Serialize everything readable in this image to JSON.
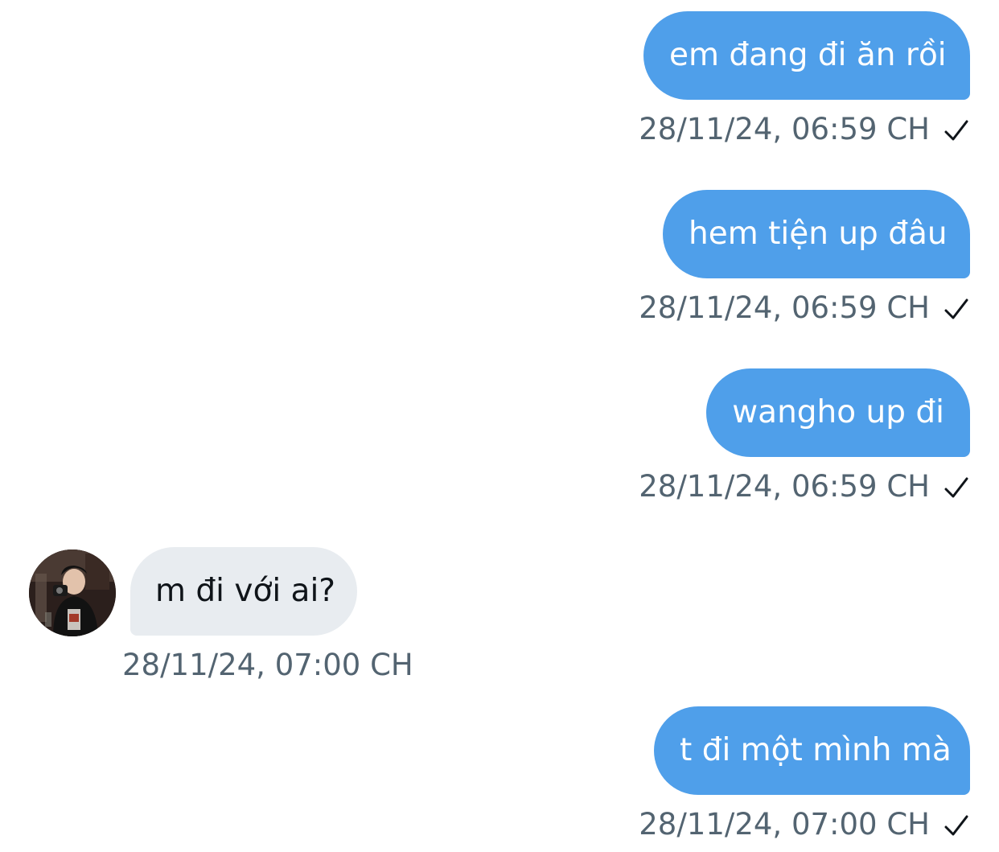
{
  "messages": [
    {
      "direction": "outgoing",
      "text": "em đang đi ăn rồi",
      "time": "28/11/24, 06:59 CH",
      "status_icon": "check-icon"
    },
    {
      "direction": "outgoing",
      "text": "hem tiện up đâu",
      "time": "28/11/24, 06:59 CH",
      "status_icon": "check-icon"
    },
    {
      "direction": "outgoing",
      "text": "wangho up đi",
      "time": "28/11/24, 06:59 CH",
      "status_icon": "check-icon"
    },
    {
      "direction": "incoming",
      "text": "m đi với ai?",
      "time": "28/11/24, 07:00 CH",
      "avatar": "user-avatar"
    },
    {
      "direction": "outgoing",
      "text": "t đi một mình mà",
      "time": "28/11/24, 07:00 CH",
      "status_icon": "check-icon"
    }
  ],
  "colors": {
    "outgoing_bubble": "#4f9fea",
    "incoming_bubble": "#e8ecf0",
    "timestamp": "#536471",
    "check": "#0f1419"
  }
}
